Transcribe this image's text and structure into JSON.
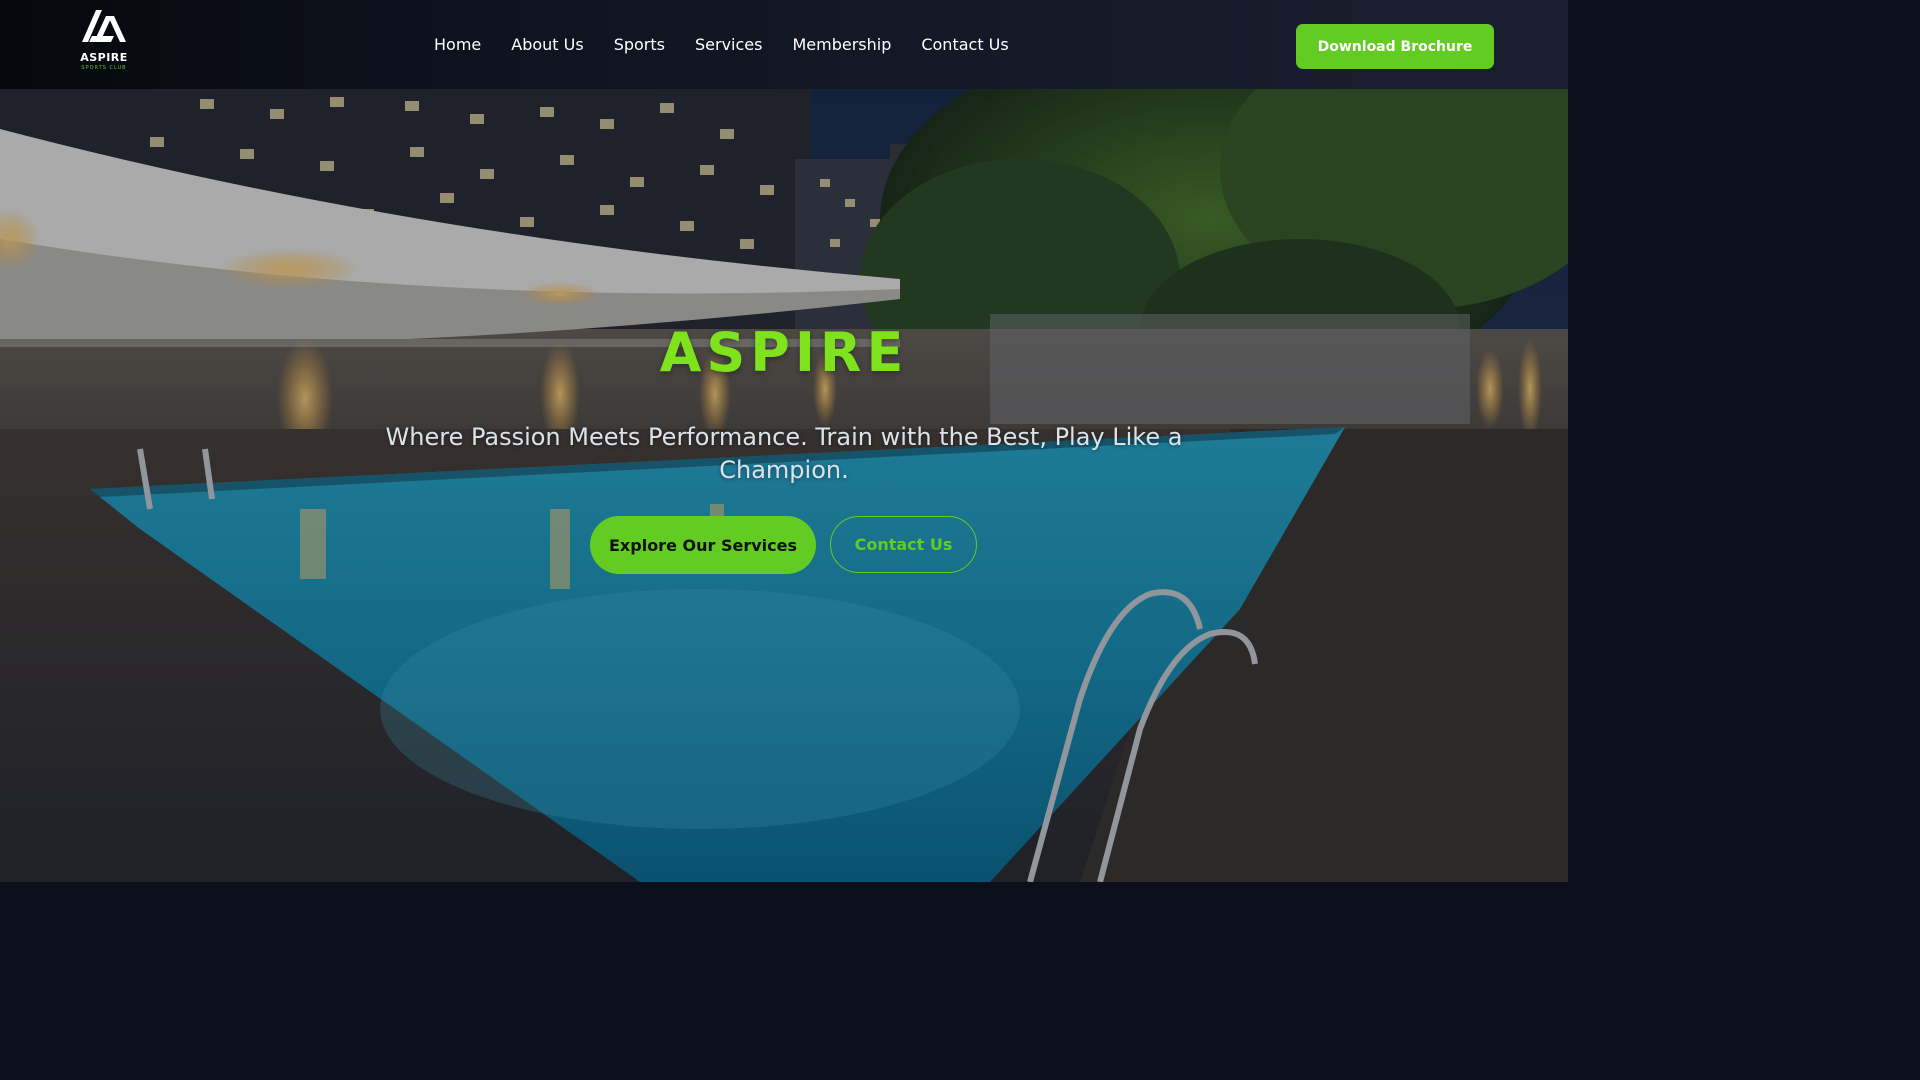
{
  "brand": {
    "logo_text": "ASPIRE",
    "logo_subtext": "SPORTS CLUB",
    "accent_color": "#63cc22"
  },
  "nav": {
    "items": [
      {
        "label": "Home"
      },
      {
        "label": "About Us"
      },
      {
        "label": "Sports"
      },
      {
        "label": "Services"
      },
      {
        "label": "Membership"
      },
      {
        "label": "Contact Us"
      }
    ],
    "cta_label": "Download Brochure"
  },
  "hero": {
    "title": "ASPIRE",
    "tagline": "Where Passion Meets Performance. Train with the Best, Play Like a Champion.",
    "primary_button": "Explore Our Services",
    "secondary_button": "Contact Us",
    "background": "swimming-pool-night-photo"
  }
}
